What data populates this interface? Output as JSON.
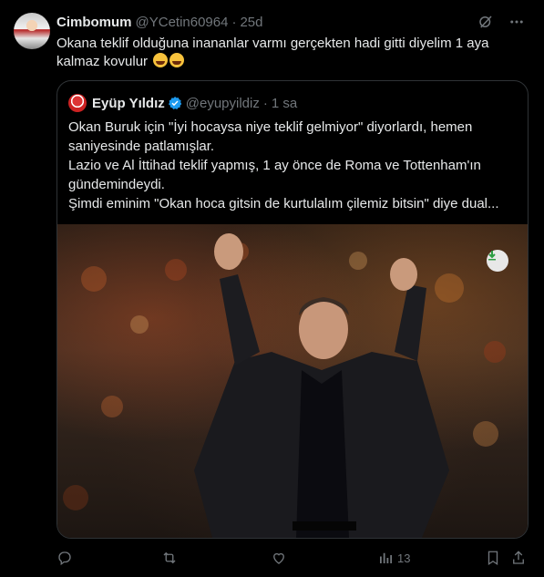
{
  "post": {
    "author_name": "Cimbomum",
    "author_handle": "@YCetin60964",
    "separator": "·",
    "time": "25d",
    "text": "Okana teklif olduğuna inananlar varmı gerçekten hadi gitti diyelim 1 aya kalmaz kovulur"
  },
  "quote": {
    "author_name": "Eyüp Yıldız",
    "author_handle": "@eyupyildiz",
    "separator": "·",
    "time": "1 sa",
    "lines": [
      "Okan Buruk için \"İyi hocaysa niye teklif gelmiyor\" diyorlardı, hemen",
      "saniyesinde patlamışlar.",
      "Lazio ve Al İttihad teklif yapmış, 1 ay önce de Roma ve Tottenham'ın",
      "gündemindeydi.",
      "Şimdi eminim \"Okan hoca gitsin de kurtulalım çilemiz bitsin\" diye dual..."
    ]
  },
  "actions": {
    "views_count": "13"
  },
  "colors": {
    "background": "#000000",
    "text_primary": "#e7e9ea",
    "text_secondary": "#71767b",
    "border": "#2f3336",
    "verified": "#1d9bf0"
  }
}
